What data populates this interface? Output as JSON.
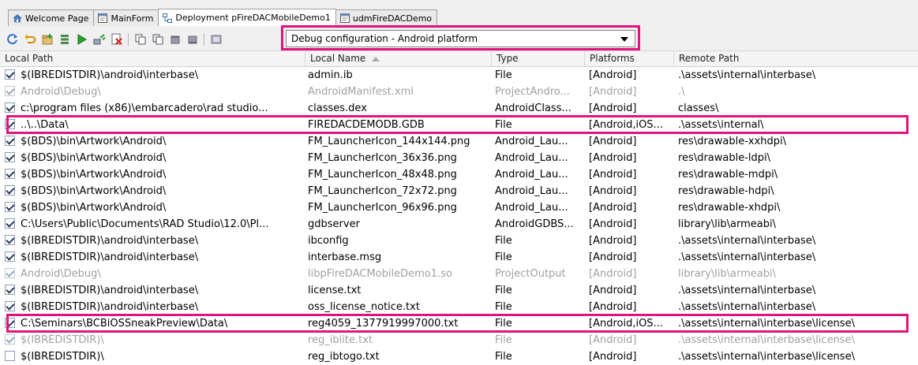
{
  "tabs": [
    {
      "label": "Welcome Page",
      "icon": "welcome-page-icon"
    },
    {
      "label": "MainForm",
      "icon": "form-icon"
    },
    {
      "label": "Deployment pFireDACMobileDemo1",
      "icon": "deployment-icon"
    },
    {
      "label": "udmFireDACDemo",
      "icon": "form-icon"
    }
  ],
  "toolbar": {
    "icons": [
      "refresh-icon",
      "revert-icon",
      "add-files-icon",
      "add-featured-files-icon",
      "deploy-icon",
      "connect-icon",
      "remove-file-icon",
      "copy-icon",
      "paste-icon",
      "move-up-icon",
      "move-down-icon",
      "options-icon"
    ],
    "configuration": "Debug configuration - Android platform"
  },
  "columns": {
    "local_path": "Local Path",
    "local_name": "Local Name",
    "type": "Type",
    "platforms": "Platforms",
    "remote_path": "Remote Path"
  },
  "rows": [
    {
      "checked": true,
      "disabled": false,
      "local_path": "$(IBREDISTDIR)\\android\\interbase\\",
      "local_name": "admin.ib",
      "type": "File",
      "platforms": "[Android]",
      "remote_path": ".\\assets\\internal\\interbase\\"
    },
    {
      "checked": true,
      "disabled": true,
      "local_path": "Android\\Debug\\",
      "local_name": "AndroidManifest.xml",
      "type": "ProjectAndro...",
      "platforms": "[Android]",
      "remote_path": ".\\"
    },
    {
      "checked": true,
      "disabled": false,
      "local_path": "c:\\program files (x86)\\embarcadero\\rad studio...",
      "local_name": "classes.dex",
      "type": "AndroidClass...",
      "platforms": "[Android]",
      "remote_path": "classes\\"
    },
    {
      "checked": true,
      "disabled": false,
      "local_path": "..\\..\\Data\\",
      "local_name": "FIREDACDEMODB.GDB",
      "type": "File",
      "platforms": "[Android,iOS...",
      "remote_path": ".\\assets\\internal\\"
    },
    {
      "checked": true,
      "disabled": false,
      "local_path": "$(BDS)\\bin\\Artwork\\Android\\",
      "local_name": "FM_LauncherIcon_144x144.png",
      "type": "Android_Lau...",
      "platforms": "[Android]",
      "remote_path": "res\\drawable-xxhdpi\\"
    },
    {
      "checked": true,
      "disabled": false,
      "local_path": "$(BDS)\\bin\\Artwork\\Android\\",
      "local_name": "FM_LauncherIcon_36x36.png",
      "type": "Android_Lau...",
      "platforms": "[Android]",
      "remote_path": "res\\drawable-ldpi\\"
    },
    {
      "checked": true,
      "disabled": false,
      "local_path": "$(BDS)\\bin\\Artwork\\Android\\",
      "local_name": "FM_LauncherIcon_48x48.png",
      "type": "Android_Lau...",
      "platforms": "[Android]",
      "remote_path": "res\\drawable-mdpi\\"
    },
    {
      "checked": true,
      "disabled": false,
      "local_path": "$(BDS)\\bin\\Artwork\\Android\\",
      "local_name": "FM_LauncherIcon_72x72.png",
      "type": "Android_Lau...",
      "platforms": "[Android]",
      "remote_path": "res\\drawable-hdpi\\"
    },
    {
      "checked": true,
      "disabled": false,
      "local_path": "$(BDS)\\bin\\Artwork\\Android\\",
      "local_name": "FM_LauncherIcon_96x96.png",
      "type": "Android_Lau...",
      "platforms": "[Android]",
      "remote_path": "res\\drawable-xhdpi\\"
    },
    {
      "checked": true,
      "disabled": false,
      "local_path": "C:\\Users\\Public\\Documents\\RAD Studio\\12.0\\Pl...",
      "local_name": "gdbserver",
      "type": "AndroidGDBS...",
      "platforms": "[Android]",
      "remote_path": "library\\lib\\armeabi\\"
    },
    {
      "checked": true,
      "disabled": false,
      "local_path": "$(IBREDISTDIR)\\android\\interbase\\",
      "local_name": "ibconfig",
      "type": "File",
      "platforms": "[Android]",
      "remote_path": ".\\assets\\internal\\interbase\\"
    },
    {
      "checked": true,
      "disabled": false,
      "local_path": "$(IBREDISTDIR)\\android\\interbase\\",
      "local_name": "interbase.msg",
      "type": "File",
      "platforms": "[Android]",
      "remote_path": ".\\assets\\internal\\interbase\\"
    },
    {
      "checked": true,
      "disabled": true,
      "local_path": "Android\\Debug\\",
      "local_name": "libpFireDACMobileDemo1.so",
      "type": "ProjectOutput",
      "platforms": "[Android]",
      "remote_path": "library\\lib\\armeabi\\"
    },
    {
      "checked": true,
      "disabled": false,
      "local_path": "$(IBREDISTDIR)\\android\\interbase\\",
      "local_name": "license.txt",
      "type": "File",
      "platforms": "[Android]",
      "remote_path": ".\\assets\\internal\\interbase\\"
    },
    {
      "checked": true,
      "disabled": false,
      "local_path": "$(IBREDISTDIR)\\android\\interbase\\",
      "local_name": "oss_license_notice.txt",
      "type": "File",
      "platforms": "[Android]",
      "remote_path": ".\\assets\\internal\\interbase\\"
    },
    {
      "checked": true,
      "disabled": false,
      "local_path": "C:\\Seminars\\BCBiOSSneakPreview\\Data\\",
      "local_name": "reg4059_1377919997000.txt",
      "type": "File",
      "platforms": "[Android,iOS...",
      "remote_path": ".\\assets\\internal\\interbase\\license\\"
    },
    {
      "checked": true,
      "disabled": true,
      "local_path": "$(IBREDISTDIR)\\",
      "local_name": "reg_iblite.txt",
      "type": "File",
      "platforms": "[Android]",
      "remote_path": ".\\assets\\internal\\interbase\\license\\"
    },
    {
      "checked": false,
      "disabled": false,
      "local_path": "$(IBREDISTDIR)\\",
      "local_name": "reg_ibtogo.txt",
      "type": "File",
      "platforms": "[Android]",
      "remote_path": ".\\assets\\internal\\interbase\\license\\"
    }
  ],
  "highlighted_rows": [
    3,
    15
  ],
  "colors": {
    "highlight": "#e0147a"
  }
}
